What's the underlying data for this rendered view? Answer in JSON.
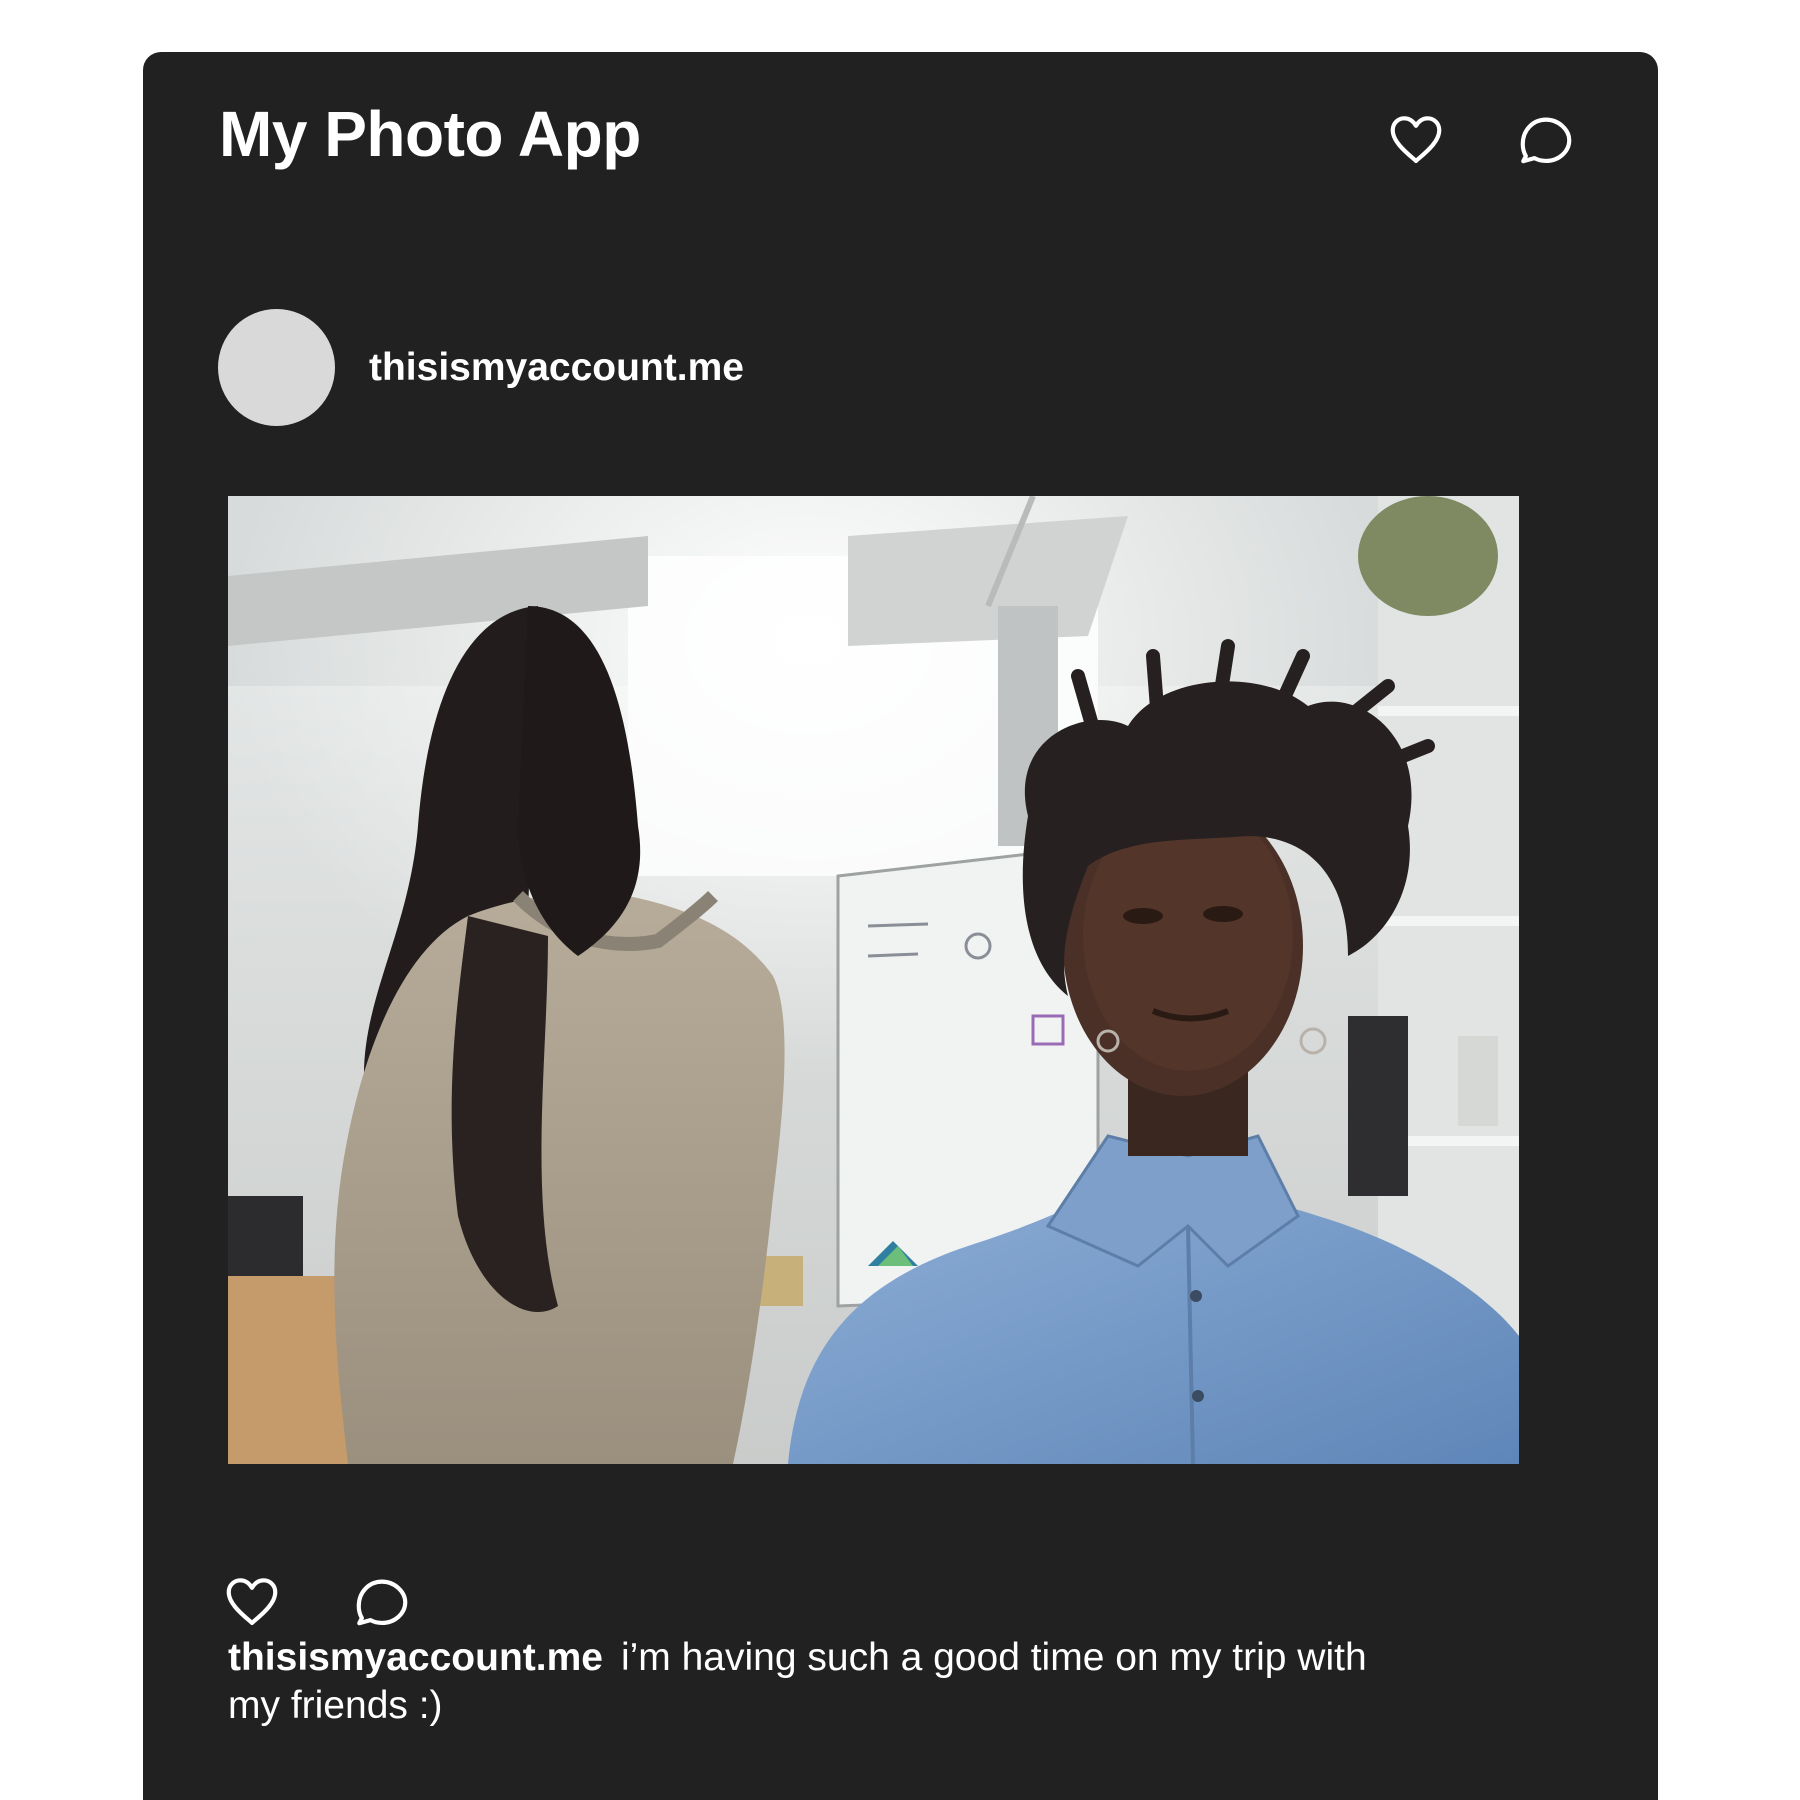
{
  "app": {
    "title": "My Photo App"
  },
  "header": {
    "actions": [
      {
        "icon": "heart-icon"
      },
      {
        "icon": "speech-bubble-icon"
      }
    ]
  },
  "post": {
    "username": "thisismyaccount.me",
    "avatar_color": "#d9d9d9",
    "photo": {
      "icon": "photo-of-two-friends-in-office"
    },
    "actions": [
      {
        "icon": "heart-icon"
      },
      {
        "icon": "speech-bubble-icon"
      }
    ],
    "caption": {
      "username": "thisismyaccount.me",
      "text": "i’m having such a good time on my trip with my friends :)"
    }
  },
  "colors": {
    "page_background": "#ffffff",
    "card_background": "#212121",
    "text": "#ffffff"
  }
}
